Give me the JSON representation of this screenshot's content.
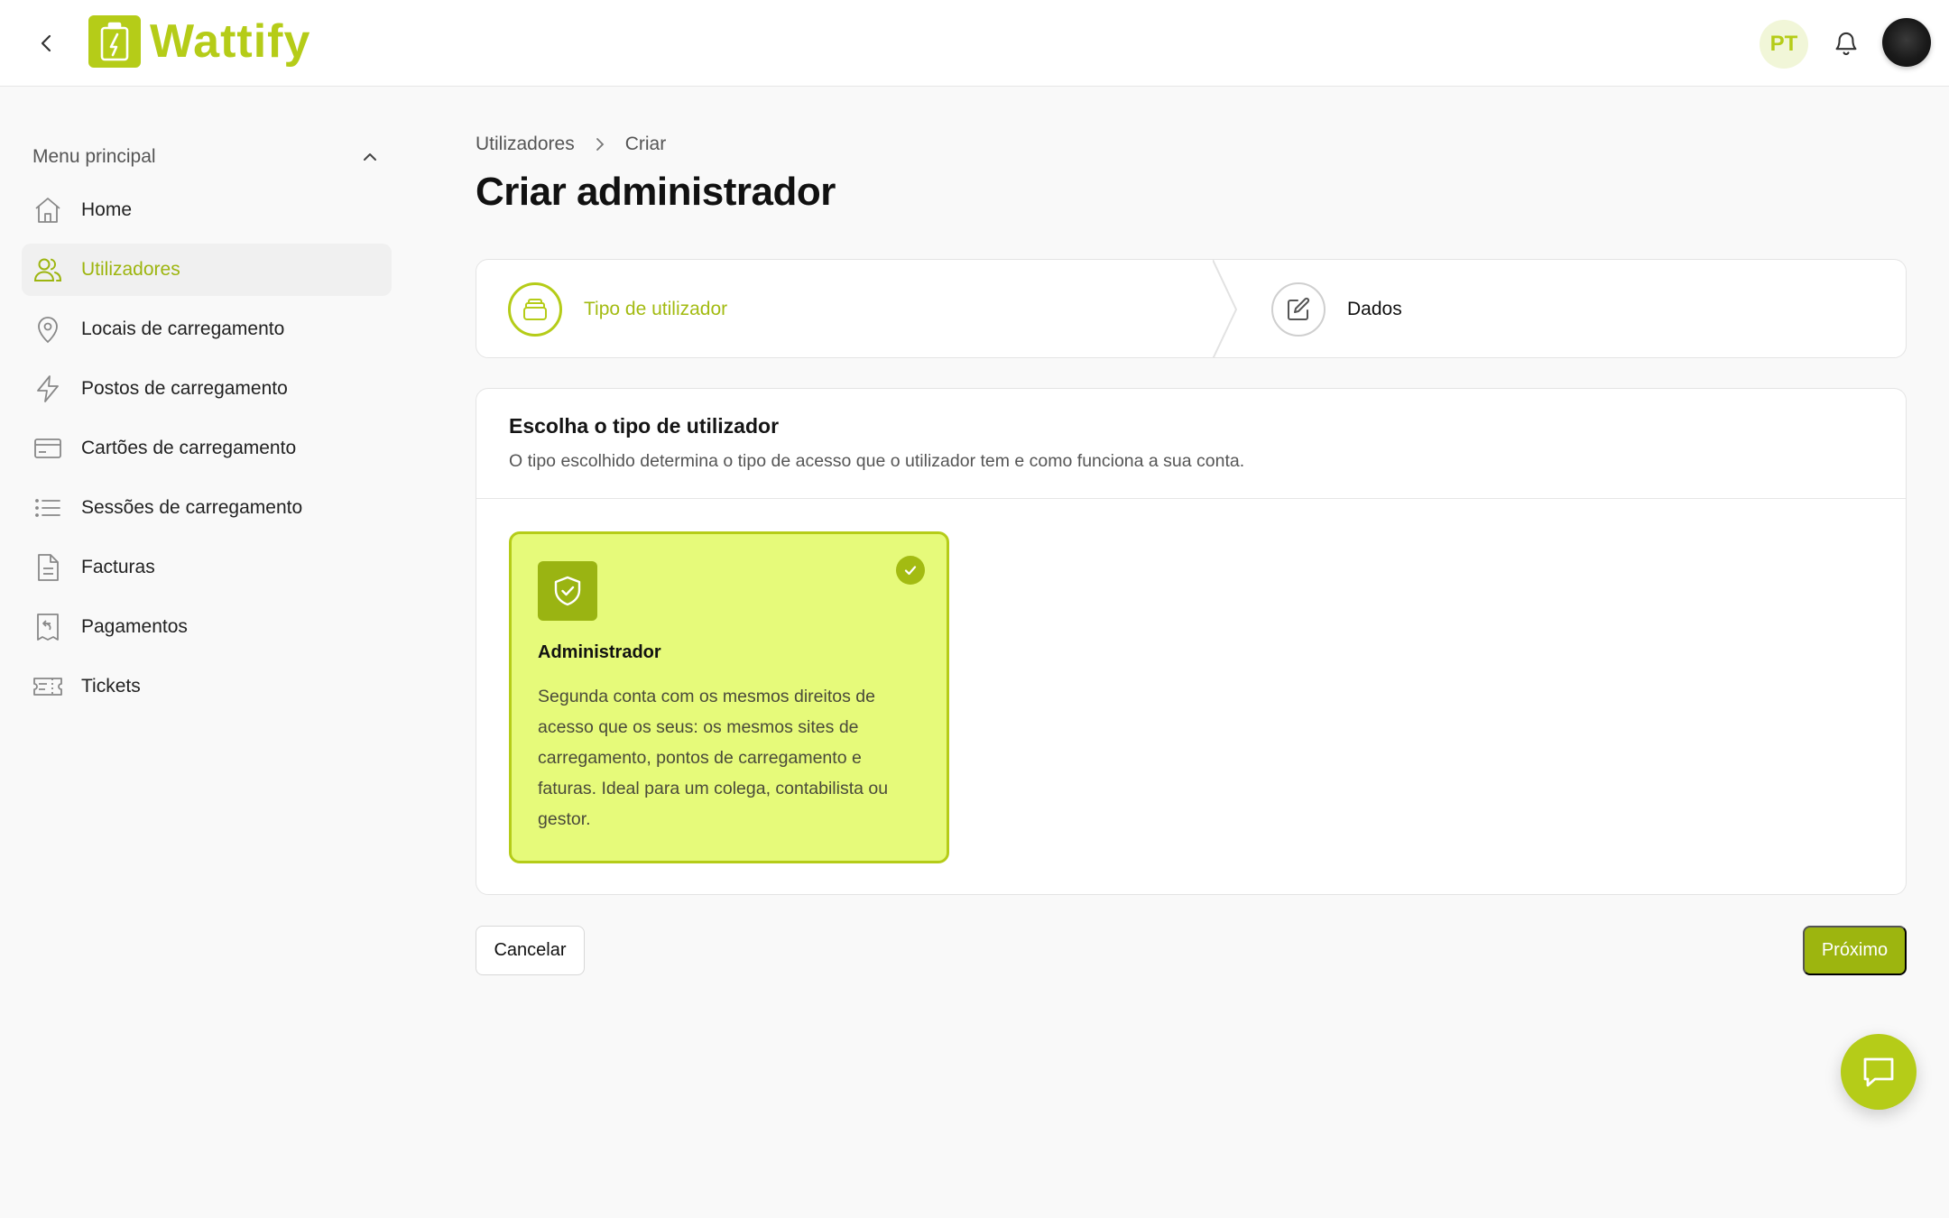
{
  "header": {
    "back_icon": "chevron-left-icon",
    "logo_text": "Wattify",
    "language": "PT",
    "bell_icon": "bell-icon"
  },
  "sidebar": {
    "title": "Menu principal",
    "items": [
      {
        "label": "Home",
        "icon": "home-icon",
        "active": false
      },
      {
        "label": "Utilizadores",
        "icon": "users-icon",
        "active": true
      },
      {
        "label": "Locais de carregamento",
        "icon": "map-pin-icon",
        "active": false
      },
      {
        "label": "Postos de carregamento",
        "icon": "lightning-icon",
        "active": false
      },
      {
        "label": "Cartões de carregamento",
        "icon": "card-icon",
        "active": false
      },
      {
        "label": "Sessões de carregamento",
        "icon": "list-icon",
        "active": false
      },
      {
        "label": "Facturas",
        "icon": "document-icon",
        "active": false
      },
      {
        "label": "Pagamentos",
        "icon": "receipt-icon",
        "active": false
      },
      {
        "label": "Tickets",
        "icon": "ticket-icon",
        "active": false
      }
    ]
  },
  "breadcrumb": {
    "items": [
      "Utilizadores",
      "Criar"
    ]
  },
  "page": {
    "title": "Criar administrador"
  },
  "stepper": {
    "steps": [
      {
        "label": "Tipo de utilizador",
        "icon": "stack-icon",
        "active": true
      },
      {
        "label": "Dados",
        "icon": "edit-icon",
        "active": false
      }
    ]
  },
  "card": {
    "title": "Escolha o tipo de utilizador",
    "description": "O tipo escolhido determina o tipo de acesso que o utilizador tem e como funciona a sua conta.",
    "option": {
      "title": "Administrador",
      "description": "Segunda conta com os mesmos direitos de acesso que os seus: os mesmos sites de carregamento, pontos de carregamento e faturas. Ideal para um colega, contabilista ou gestor.",
      "selected": true
    }
  },
  "actions": {
    "cancel_label": "Cancelar",
    "next_label": "Próximo"
  },
  "colors": {
    "accent": "#b5cc18",
    "accent_dark": "#9db50f",
    "option_bg": "#e6fa7a",
    "page_bg": "#f9f9f9"
  }
}
